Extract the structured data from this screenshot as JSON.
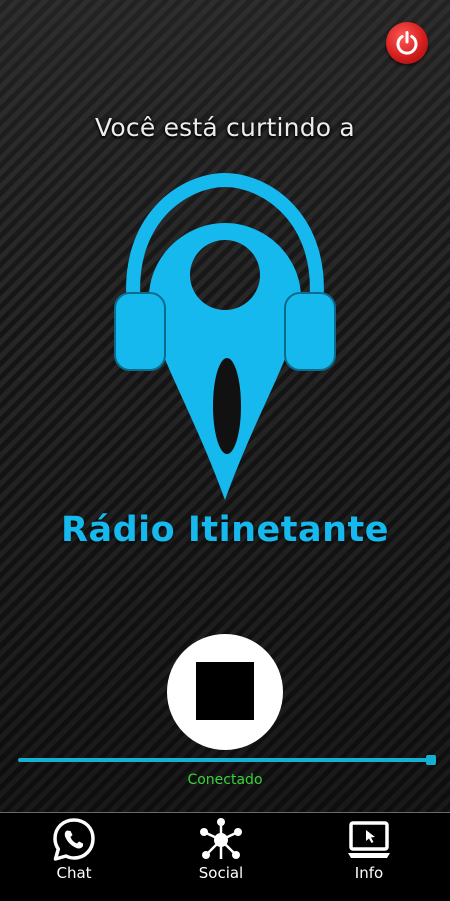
{
  "header": {
    "tagline": "Você está curtindo a",
    "power_icon": "power-icon"
  },
  "station": {
    "name": "Rádio Itinetante",
    "logo": "headphone-location-pin-logo",
    "brand_color": "#15b9ee"
  },
  "player": {
    "control_icon": "stop-icon",
    "progress": 1.0,
    "status": "Conectado",
    "status_color": "#39d23c"
  },
  "bottom_nav": {
    "items": [
      {
        "label": "Chat",
        "icon": "whatsapp-icon"
      },
      {
        "label": "Social",
        "icon": "social-network-icon"
      },
      {
        "label": "Info",
        "icon": "info-monitor-icon"
      }
    ]
  }
}
